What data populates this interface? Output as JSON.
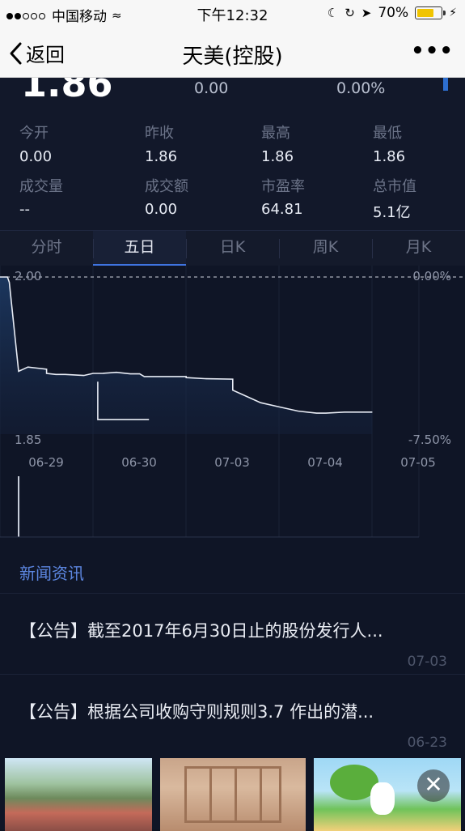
{
  "status_bar": {
    "carrier": "中国移动",
    "time": "下午12:32",
    "battery": "70%",
    "battery_level": 0.7
  },
  "nav": {
    "back_label": "返回",
    "title": "天美(控股)",
    "more_label": "•••"
  },
  "quote": {
    "price": "1.86",
    "change": "0.00",
    "change_pct": "0.00%"
  },
  "stats": [
    {
      "label": "今开",
      "value": "0.00"
    },
    {
      "label": "昨收",
      "value": "1.86"
    },
    {
      "label": "最高",
      "value": "1.86"
    },
    {
      "label": "最低",
      "value": "1.86"
    },
    {
      "label": "成交量",
      "value": "--"
    },
    {
      "label": "成交额",
      "value": "0.00"
    },
    {
      "label": "市盈率",
      "value": "64.81"
    },
    {
      "label": "总市值",
      "value": "5.1亿"
    }
  ],
  "tabs": [
    {
      "label": "分时",
      "active": false
    },
    {
      "label": "五日",
      "active": true
    },
    {
      "label": "日K",
      "active": false
    },
    {
      "label": "周K",
      "active": false
    },
    {
      "label": "月K",
      "active": false
    }
  ],
  "chart_data": {
    "type": "line",
    "x_labels": [
      "06-29",
      "06-30",
      "07-03",
      "07-04",
      "07-05"
    ],
    "y_max_label": "2.00",
    "y_min_label": "1.85",
    "pct_max_label": "0.00%",
    "pct_min_label": "-7.50%",
    "ylim": [
      1.85,
      2.0
    ],
    "series": [
      {
        "values": [
          [
            0,
            2.0
          ],
          [
            0.08,
            2.0
          ],
          [
            0.1,
            1.995
          ],
          [
            0.2,
            1.91
          ],
          [
            0.25,
            1.912
          ],
          [
            0.3,
            1.914
          ],
          [
            0.4,
            1.913
          ],
          [
            0.5,
            1.912
          ],
          [
            0.5,
            1.908
          ],
          [
            0.6,
            1.907
          ],
          [
            0.7,
            1.907
          ],
          [
            0.8,
            1.9065
          ],
          [
            0.9,
            1.906
          ],
          [
            1.0,
            1.908
          ],
          [
            1.1,
            1.908
          ],
          [
            1.25,
            1.909
          ],
          [
            1.4,
            1.9075
          ],
          [
            1.5,
            1.9075
          ],
          [
            1.55,
            1.905
          ],
          [
            1.7,
            1.905
          ],
          [
            2.0,
            1.905
          ],
          [
            2.0,
            1.904
          ],
          [
            2.2,
            1.903
          ],
          [
            2.5,
            1.9025
          ],
          [
            2.5,
            1.892
          ],
          [
            2.6,
            1.888
          ],
          [
            2.8,
            1.88
          ],
          [
            3.0,
            1.876
          ],
          [
            3.2,
            1.872
          ],
          [
            3.4,
            1.87
          ],
          [
            3.5,
            1.87
          ],
          [
            3.7,
            1.871
          ],
          [
            4.0,
            1.871
          ]
        ]
      },
      {
        "values": [
          [
            1.05,
            1.9
          ],
          [
            1.05,
            1.864
          ],
          [
            1.6,
            1.864
          ]
        ]
      }
    ],
    "volume_spike_x": 0.2
  },
  "news": {
    "header": "新闻资讯",
    "items": [
      {
        "text": "【公告】截至2017年6月30日止的股份发行人...",
        "date": "07-03"
      },
      {
        "text": "【公告】根据公司收购守则规则3.7 作出的潜...",
        "date": "06-23"
      }
    ]
  },
  "ad": {
    "close_label": "✕"
  },
  "colors": {
    "bg": "#0d1321",
    "accent": "#3f74e0",
    "line": "#e8ecf5"
  }
}
